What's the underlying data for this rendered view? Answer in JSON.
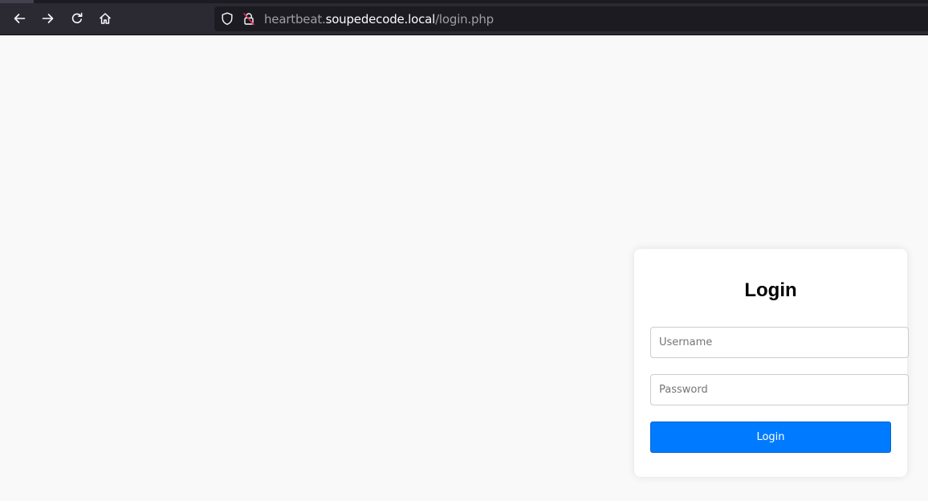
{
  "browser": {
    "url_scheme_prefix": "heartbeat.",
    "url_host": "soupedecode.local",
    "url_path": "/login.php",
    "icons": {
      "back": "arrow-left-icon",
      "forward": "arrow-right-icon",
      "reload": "reload-icon",
      "home": "home-icon",
      "tracking": "shield-icon",
      "insecure": "insecure-lock-icon"
    },
    "colors": {
      "toolbar": "#2b2a33",
      "urlbar": "#1c1b22",
      "url_dim": "#a09fa6",
      "url_host": "#fbfbfe"
    }
  },
  "login": {
    "title": "Login",
    "username_placeholder": "Username",
    "password_placeholder": "Password",
    "submit_label": "Login",
    "colors": {
      "button": "#007bff",
      "page_bg": "#f9f9f9",
      "card_bg": "#ffffff"
    }
  }
}
